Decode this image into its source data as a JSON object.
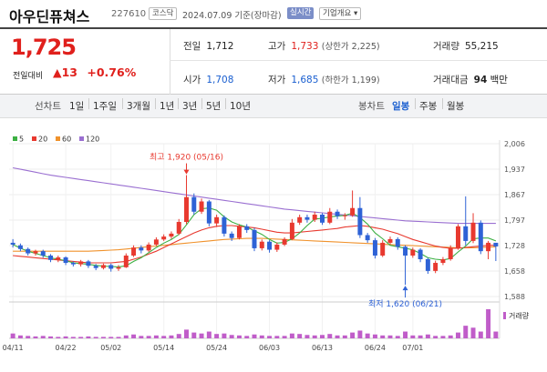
{
  "header": {
    "name": "아우딘퓨쳐스",
    "code": "227610",
    "market": "코스닥",
    "date": "2024.07.09 기준(장마감)",
    "realtime": "실시간",
    "company_info": "기업개요 ▾"
  },
  "price": {
    "current": "1,725",
    "change_label": "전일대비",
    "change": "▲13",
    "change_pct": "+0.76%"
  },
  "stats": {
    "prev": {
      "label": "전일",
      "value": "1,712"
    },
    "high": {
      "label": "고가",
      "value": "1,733",
      "sub": "(상한가 2,225)"
    },
    "volume": {
      "label": "거래량",
      "value": "55,215"
    },
    "open": {
      "label": "시가",
      "value": "1,708"
    },
    "low": {
      "label": "저가",
      "value": "1,685",
      "sub": "(하한가 1,199)"
    },
    "amount": {
      "label": "거래대금",
      "value": "94",
      "unit": "백만"
    }
  },
  "tabs": {
    "line_label": "선차트",
    "line_items": [
      "1일",
      "1주일",
      "3개월",
      "1년",
      "3년",
      "5년",
      "10년"
    ],
    "candle_label": "봉차트",
    "candle_items": [
      "일봉",
      "주봉",
      "월봉"
    ],
    "candle_active": "일봉"
  },
  "chart_data": {
    "type": "candlestick",
    "legend": [
      {
        "name": "5",
        "color": "#3cb043"
      },
      {
        "name": "20",
        "color": "#e8392f"
      },
      {
        "name": "60",
        "color": "#f0922c"
      },
      {
        "name": "120",
        "color": "#9a6fd1"
      }
    ],
    "y_ticks": [
      "2,006",
      "1,937",
      "1,867",
      "1,797",
      "1,728",
      "1,658",
      "1,588"
    ],
    "ylim": [
      1588,
      2006
    ],
    "x_ticks": [
      "04/11",
      "04/22",
      "05/02",
      "05/14",
      "05/24",
      "06/03",
      "06/13",
      "06/24",
      "07/01"
    ],
    "high_annotation": "최고 1,920 (05/16)",
    "low_annotation": "최저 1,620 (06/21)",
    "volume_label": "거래량",
    "up_color": "#e8392f",
    "down_color": "#2e62d6",
    "candles": [
      [
        1735,
        1730,
        1745,
        1722
      ],
      [
        1728,
        1718,
        1733,
        1712
      ],
      [
        1718,
        1706,
        1722,
        1700
      ],
      [
        1706,
        1712,
        1716,
        1700
      ],
      [
        1712,
        1700,
        1716,
        1694
      ],
      [
        1700,
        1688,
        1704,
        1682
      ],
      [
        1688,
        1695,
        1700,
        1682
      ],
      [
        1695,
        1680,
        1698,
        1674
      ],
      [
        1680,
        1676,
        1684,
        1670
      ],
      [
        1676,
        1684,
        1688,
        1670
      ],
      [
        1684,
        1672,
        1688,
        1666
      ],
      [
        1672,
        1666,
        1677,
        1660
      ],
      [
        1666,
        1674,
        1678,
        1662
      ],
      [
        1674,
        1664,
        1678,
        1656
      ],
      [
        1664,
        1668,
        1674,
        1658
      ],
      [
        1668,
        1700,
        1706,
        1666
      ],
      [
        1700,
        1722,
        1728,
        1696
      ],
      [
        1722,
        1714,
        1728,
        1706
      ],
      [
        1714,
        1730,
        1736,
        1710
      ],
      [
        1730,
        1744,
        1750,
        1726
      ],
      [
        1744,
        1752,
        1758,
        1740
      ],
      [
        1752,
        1760,
        1766,
        1746
      ],
      [
        1760,
        1792,
        1800,
        1756
      ],
      [
        1792,
        1860,
        1920,
        1786
      ],
      [
        1860,
        1820,
        1870,
        1812
      ],
      [
        1820,
        1848,
        1856,
        1814
      ],
      [
        1848,
        1788,
        1852,
        1780
      ],
      [
        1788,
        1805,
        1812,
        1778
      ],
      [
        1805,
        1760,
        1810,
        1752
      ],
      [
        1760,
        1748,
        1766,
        1740
      ],
      [
        1748,
        1780,
        1786,
        1744
      ],
      [
        1780,
        1770,
        1786,
        1762
      ],
      [
        1770,
        1720,
        1776,
        1712
      ],
      [
        1720,
        1738,
        1744,
        1714
      ],
      [
        1738,
        1716,
        1742,
        1708
      ],
      [
        1716,
        1730,
        1736,
        1710
      ],
      [
        1730,
        1745,
        1750,
        1726
      ],
      [
        1745,
        1790,
        1800,
        1742
      ],
      [
        1790,
        1805,
        1812,
        1784
      ],
      [
        1805,
        1798,
        1812,
        1790
      ],
      [
        1798,
        1812,
        1820,
        1792
      ],
      [
        1812,
        1790,
        1816,
        1784
      ],
      [
        1790,
        1820,
        1830,
        1786
      ],
      [
        1820,
        1808,
        1826,
        1800
      ],
      [
        1808,
        1810,
        1816,
        1798
      ],
      [
        1810,
        1830,
        1878,
        1806
      ],
      [
        1830,
        1756,
        1860,
        1748
      ],
      [
        1756,
        1742,
        1762,
        1735
      ],
      [
        1742,
        1700,
        1748,
        1692
      ],
      [
        1700,
        1735,
        1742,
        1696
      ],
      [
        1735,
        1745,
        1752,
        1730
      ],
      [
        1745,
        1724,
        1750,
        1716
      ],
      [
        1724,
        1700,
        1728,
        1620
      ],
      [
        1700,
        1716,
        1722,
        1694
      ],
      [
        1716,
        1690,
        1720,
        1682
      ],
      [
        1690,
        1658,
        1694,
        1650
      ],
      [
        1658,
        1680,
        1686,
        1652
      ],
      [
        1680,
        1690,
        1696,
        1674
      ],
      [
        1690,
        1720,
        1728,
        1686
      ],
      [
        1720,
        1780,
        1786,
        1716
      ],
      [
        1780,
        1740,
        1862,
        1728
      ],
      [
        1740,
        1790,
        1816,
        1734
      ],
      [
        1790,
        1712,
        1796,
        1704
      ],
      [
        1712,
        1735,
        1740,
        1690
      ],
      [
        1735,
        1725,
        1733,
        1685
      ]
    ],
    "ma5": [
      1730,
      1720,
      1712,
      1706,
      1700,
      1694,
      1690,
      1686,
      1680,
      1678,
      1676,
      1673,
      1671,
      1670,
      1669,
      1672,
      1684,
      1694,
      1708,
      1722,
      1734,
      1744,
      1758,
      1784,
      1812,
      1828,
      1830,
      1824,
      1806,
      1792,
      1784,
      1778,
      1768,
      1758,
      1744,
      1734,
      1736,
      1746,
      1762,
      1782,
      1800,
      1802,
      1806,
      1808,
      1810,
      1816,
      1804,
      1786,
      1762,
      1746,
      1728,
      1724,
      1720,
      1716,
      1706,
      1694,
      1690,
      1688,
      1692,
      1710,
      1726,
      1746,
      1748,
      1748,
      1740
    ],
    "ma20": [
      1700,
      1698,
      1696,
      1694,
      1692,
      1690,
      1688,
      1686,
      1684,
      1682,
      1680,
      1680,
      1680,
      1680,
      1682,
      1684,
      1690,
      1696,
      1704,
      1712,
      1722,
      1732,
      1742,
      1752,
      1762,
      1770,
      1776,
      1780,
      1782,
      1782,
      1780,
      1778,
      1776,
      1772,
      1768,
      1764,
      1762,
      1762,
      1764,
      1766,
      1768,
      1770,
      1772,
      1774,
      1778,
      1780,
      1782,
      1780,
      1776,
      1772,
      1766,
      1760,
      1752,
      1744,
      1738,
      1732,
      1726,
      1722,
      1720,
      1720,
      1722,
      1724,
      1726,
      1728,
      1728
    ],
    "ma60": [
      1712,
      1712,
      1712,
      1712,
      1712,
      1712,
      1712,
      1712,
      1712,
      1712,
      1712,
      1713,
      1714,
      1715,
      1716,
      1718,
      1720,
      1722,
      1724,
      1726,
      1728,
      1730,
      1732,
      1734,
      1736,
      1738,
      1740,
      1742,
      1744,
      1745,
      1746,
      1747,
      1747,
      1747,
      1746,
      1745,
      1744,
      1743,
      1742,
      1741,
      1740,
      1739,
      1738,
      1737,
      1736,
      1735,
      1734,
      1733,
      1732,
      1731,
      1730,
      1729,
      1728,
      1727,
      1726,
      1725,
      1724,
      1723,
      1722,
      1721,
      1721,
      1721,
      1722,
      1723,
      1724
    ],
    "ma120": [
      1940,
      1936,
      1932,
      1928,
      1924,
      1920,
      1917,
      1914,
      1911,
      1908,
      1905,
      1902,
      1899,
      1896,
      1893,
      1890,
      1887,
      1884,
      1881,
      1878,
      1875,
      1872,
      1869,
      1866,
      1863,
      1860,
      1857,
      1854,
      1851,
      1848,
      1845,
      1842,
      1839,
      1836,
      1833,
      1830,
      1827,
      1825,
      1823,
      1821,
      1819,
      1817,
      1815,
      1813,
      1811,
      1809,
      1807,
      1805,
      1803,
      1801,
      1799,
      1797,
      1795,
      1794,
      1793,
      1792,
      1791,
      1790,
      1789,
      1788,
      1788,
      1788,
      1788,
      1788,
      1788
    ],
    "volumes": [
      10,
      6,
      5,
      4,
      5,
      4,
      3,
      4,
      3,
      3,
      4,
      3,
      3,
      3,
      3,
      6,
      8,
      5,
      5,
      6,
      5,
      6,
      9,
      18,
      12,
      10,
      14,
      9,
      10,
      7,
      6,
      5,
      8,
      6,
      5,
      5,
      5,
      10,
      9,
      7,
      6,
      7,
      9,
      6,
      6,
      12,
      16,
      10,
      8,
      6,
      6,
      5,
      14,
      6,
      6,
      8,
      5,
      5,
      6,
      12,
      26,
      22,
      14,
      60,
      14
    ]
  }
}
